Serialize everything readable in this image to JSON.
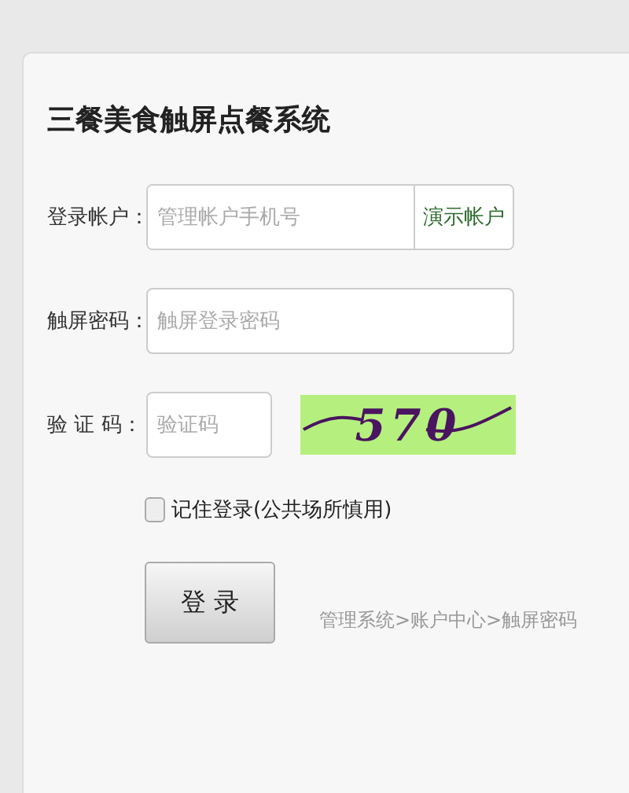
{
  "title": "三餐美食触屏点餐系统",
  "fields": [
    {
      "label": "登录帐户：",
      "placeholder": "管理帐户手机号",
      "button": "演示帐户"
    },
    {
      "label": "触屏密码：",
      "placeholder": "触屏登录密码"
    },
    {
      "label": "验 证 码：",
      "placeholder": "验证码",
      "captcha": "570"
    }
  ],
  "remember": {
    "label": "记住登录(公共场所慎用)",
    "checked": false
  },
  "login_button": "登 录",
  "hint": "管理系统>账户中心>触屏密码"
}
